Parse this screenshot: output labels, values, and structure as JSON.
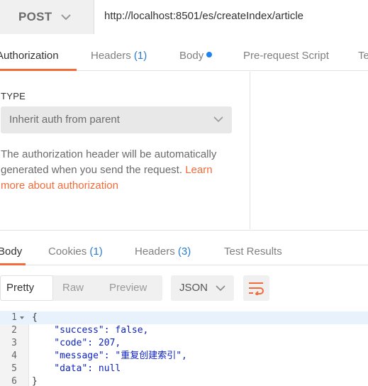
{
  "request": {
    "method": "POST",
    "url": "http://localhost:8501/es/createIndex/article"
  },
  "request_tabs": [
    {
      "label": "Authorization",
      "count": ""
    },
    {
      "label": "Headers ",
      "count": "(1)"
    },
    {
      "label": "Body",
      "count": ""
    },
    {
      "label": "Pre-request Script",
      "count": ""
    },
    {
      "label": "Te",
      "count": ""
    }
  ],
  "auth": {
    "type_label": "TYPE",
    "type_value": "Inherit auth from parent",
    "description": "The authorization header will be automatically generated when you send the request. ",
    "link_text": "Learn more about authorization"
  },
  "response_tabs": [
    {
      "label": "Body",
      "count": ""
    },
    {
      "label": "Cookies ",
      "count": "(1)"
    },
    {
      "label": "Headers ",
      "count": "(3)"
    },
    {
      "label": "Test Results",
      "count": ""
    }
  ],
  "view_modes": [
    "Pretty",
    "Raw",
    "Preview"
  ],
  "format": "JSON",
  "colors": {
    "accent": "#f26b3a",
    "link_count": "#2a7ccf",
    "body_dot": "#1d83f0"
  },
  "response_body": {
    "line_numbers": [
      "1",
      "2",
      "3",
      "4",
      "5",
      "6"
    ],
    "lines": [
      "{",
      "    \"success\": false,",
      "    \"code\": 207,",
      "    \"message\": \"重复创建索引\",",
      "    \"data\": null",
      "}"
    ]
  }
}
